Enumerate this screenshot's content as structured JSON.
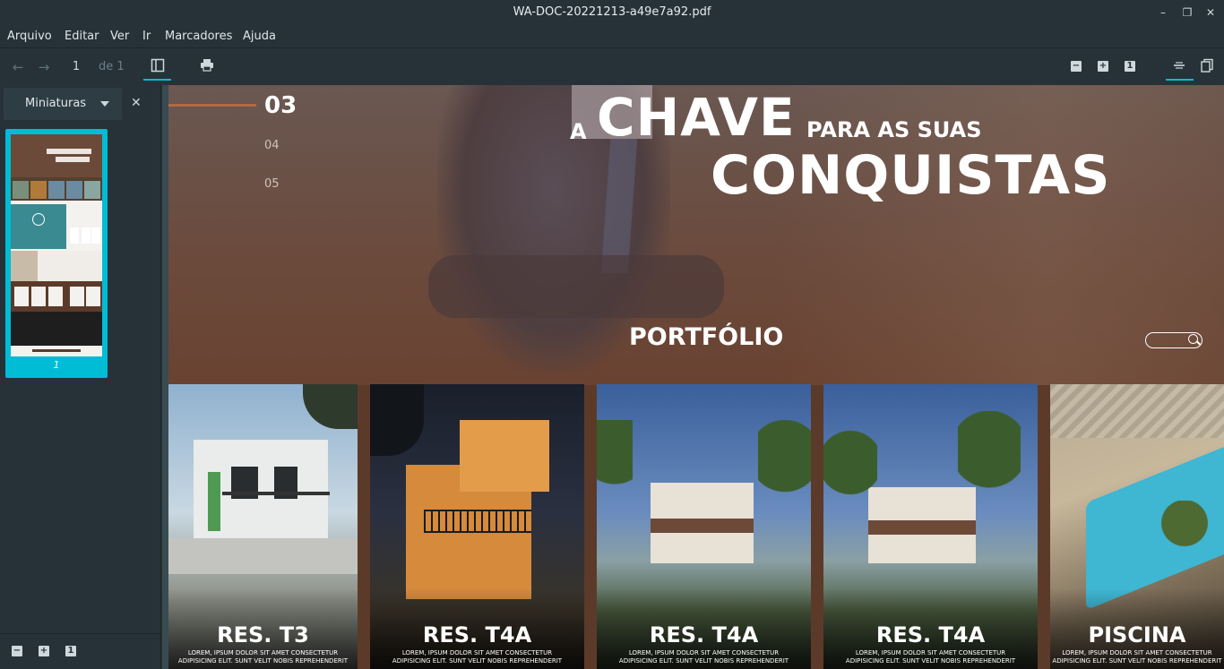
{
  "window": {
    "title": "WA-DOC-20221213-a49e7a92.pdf"
  },
  "menu": [
    "Arquivo",
    "Editar",
    "Ver",
    "Ir",
    "Marcadores",
    "Ajuda"
  ],
  "toolbar": {
    "page_current": "1",
    "page_of": "de 1"
  },
  "sidebar": {
    "mode_label": "Miniaturas",
    "thumbnail_label": "1"
  },
  "document": {
    "nav": {
      "active": "03",
      "items": [
        "04",
        "05"
      ]
    },
    "slogan": {
      "a": "A",
      "chave": "CHAVE",
      "para": "PARA AS SUAS",
      "conquistas": "CONQUISTAS"
    },
    "section_title": "PORTFÓLIO",
    "cards": [
      {
        "title": "RES. T3",
        "subtitle_line1": "LOREM, IPSUM DOLOR SIT AMET CONSECTETUR",
        "subtitle_line2": "ADIPISICING ELIT. SUNT VELIT NOBIS REPREHENDERIT"
      },
      {
        "title": "RES. T4A",
        "subtitle_line1": "LOREM, IPSUM DOLOR SIT AMET CONSECTETUR",
        "subtitle_line2": "ADIPISICING ELIT. SUNT VELIT NOBIS REPREHENDERIT"
      },
      {
        "title": "RES. T4A",
        "subtitle_line1": "LOREM, IPSUM DOLOR SIT AMET CONSECTETUR",
        "subtitle_line2": "ADIPISICING ELIT. SUNT VELIT NOBIS REPREHENDERIT"
      },
      {
        "title": "RES. T4A",
        "subtitle_line1": "LOREM, IPSUM DOLOR SIT AMET CONSECTETUR",
        "subtitle_line2": "ADIPISICING ELIT. SUNT VELIT NOBIS REPREHENDERIT"
      },
      {
        "title": "PISCINA",
        "subtitle_line1": "LOREM, IPSUM DOLOR SIT AMET CONSECTETUR",
        "subtitle_line2": "ADIPISICING ELIT. SUNT VELIT NOBIS REPREHENDERIT"
      }
    ]
  },
  "colors": {
    "accent": "#00bcd4",
    "chrome": "#263238",
    "brand_brown": "#5c3a29",
    "nav_line": "#b06a45"
  },
  "icons": [
    "minimize-icon",
    "restore-icon",
    "close-icon",
    "back-arrow-icon",
    "forward-arrow-icon",
    "sidebar-toggle-icon",
    "print-icon",
    "zoom-out-icon",
    "zoom-in-icon",
    "zoom-reset-icon",
    "continuous-scroll-icon",
    "dual-page-icon",
    "search-icon"
  ]
}
